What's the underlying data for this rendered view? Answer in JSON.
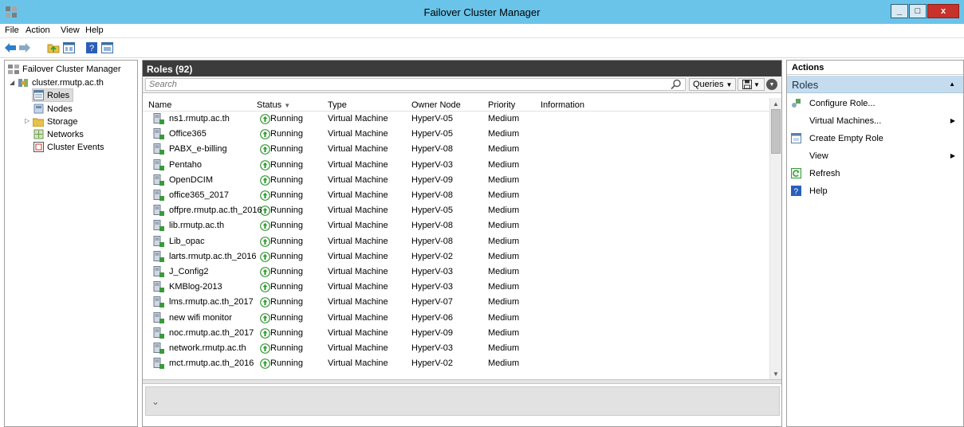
{
  "window": {
    "title": "Failover Cluster Manager",
    "minimize": "_",
    "maximize": "□",
    "close": "x"
  },
  "menu": [
    "File",
    "Action",
    "View",
    "Help"
  ],
  "tree": {
    "root": "Failover Cluster Manager",
    "cluster": "cluster.rmutp.ac.th",
    "items": [
      "Roles",
      "Nodes",
      "Storage",
      "Networks",
      "Cluster Events"
    ]
  },
  "roles": {
    "header": "Roles (92)",
    "search_placeholder": "Search",
    "queries_label": "Queries",
    "columns": [
      "Name",
      "Status",
      "Type",
      "Owner Node",
      "Priority",
      "Information"
    ],
    "rows": [
      [
        "ns1.rmutp.ac.th",
        "Running",
        "Virtual Machine",
        "HyperV-05",
        "Medium",
        ""
      ],
      [
        "Office365",
        "Running",
        "Virtual Machine",
        "HyperV-05",
        "Medium",
        ""
      ],
      [
        "PABX_e-billing",
        "Running",
        "Virtual Machine",
        "HyperV-08",
        "Medium",
        ""
      ],
      [
        "Pentaho",
        "Running",
        "Virtual Machine",
        "HyperV-03",
        "Medium",
        ""
      ],
      [
        "OpenDCIM",
        "Running",
        "Virtual Machine",
        "HyperV-09",
        "Medium",
        ""
      ],
      [
        "office365_2017",
        "Running",
        "Virtual Machine",
        "HyperV-08",
        "Medium",
        ""
      ],
      [
        "offpre.rmutp.ac.th_2016",
        "Running",
        "Virtual Machine",
        "HyperV-05",
        "Medium",
        ""
      ],
      [
        "lib.rmutp.ac.th",
        "Running",
        "Virtual Machine",
        "HyperV-08",
        "Medium",
        ""
      ],
      [
        "Lib_opac",
        "Running",
        "Virtual Machine",
        "HyperV-08",
        "Medium",
        ""
      ],
      [
        "larts.rmutp.ac.th_2016",
        "Running",
        "Virtual Machine",
        "HyperV-02",
        "Medium",
        ""
      ],
      [
        "J_Config2",
        "Running",
        "Virtual Machine",
        "HyperV-03",
        "Medium",
        ""
      ],
      [
        "KMBlog-2013",
        "Running",
        "Virtual Machine",
        "HyperV-03",
        "Medium",
        ""
      ],
      [
        "lms.rmutp.ac.th_2017",
        "Running",
        "Virtual Machine",
        "HyperV-07",
        "Medium",
        ""
      ],
      [
        "new wifi monitor",
        "Running",
        "Virtual Machine",
        "HyperV-06",
        "Medium",
        ""
      ],
      [
        "noc.rmutp.ac.th_2017",
        "Running",
        "Virtual Machine",
        "HyperV-09",
        "Medium",
        ""
      ],
      [
        "network.rmutp.ac.th",
        "Running",
        "Virtual Machine",
        "HyperV-03",
        "Medium",
        ""
      ],
      [
        "mct.rmutp.ac.th_2016",
        "Running",
        "Virtual Machine",
        "HyperV-02",
        "Medium",
        ""
      ]
    ]
  },
  "actions": {
    "title": "Actions",
    "section": "Roles",
    "items": [
      "Configure Role...",
      "Virtual Machines...",
      "Create Empty Role",
      "View",
      "Refresh",
      "Help"
    ]
  },
  "colors": {
    "titlebar": "#6ac4ea",
    "header_dark": "#3c3c3c",
    "actions_section": "#c5dcef",
    "running_green": "#3a9a3a"
  }
}
